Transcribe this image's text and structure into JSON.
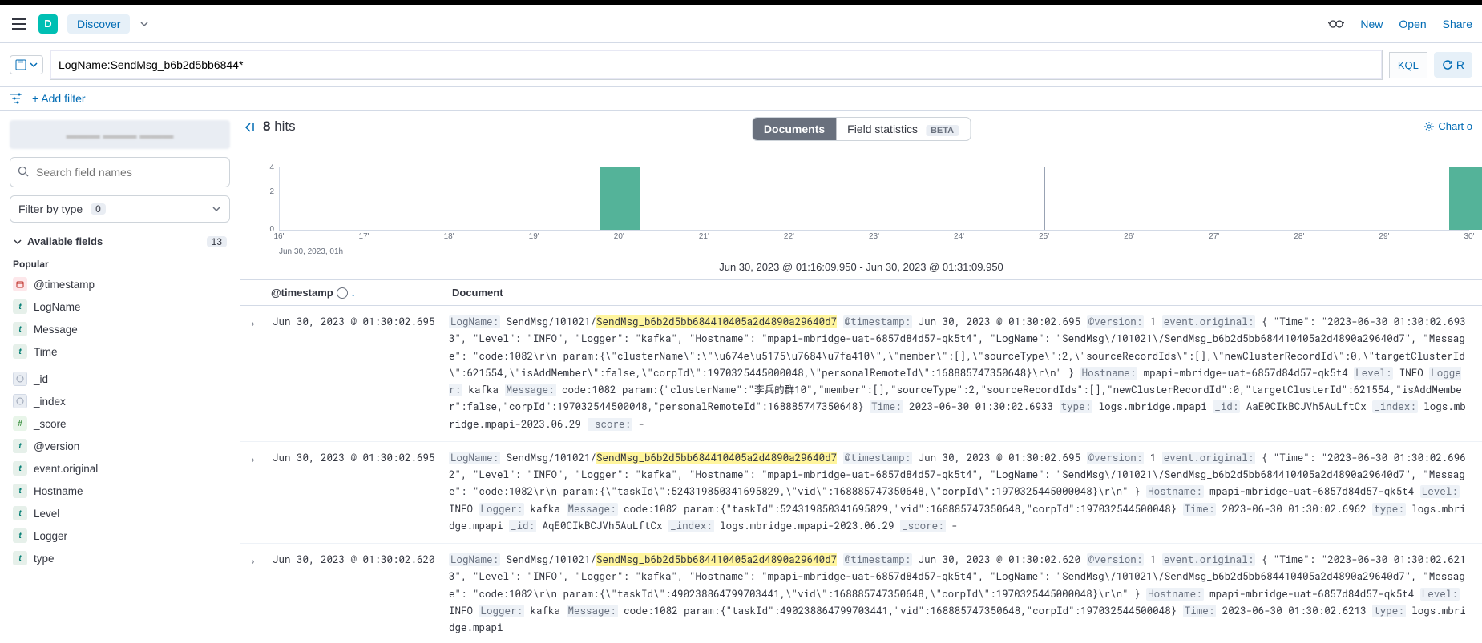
{
  "header": {
    "logo_letter": "D",
    "app_name": "Discover",
    "links": {
      "new": "New",
      "open": "Open",
      "share": "Share"
    }
  },
  "query": {
    "value": "LogName:SendMsg_b6b2d5bb6844*",
    "lang_badge": "KQL",
    "refresh_label": "R"
  },
  "filterbar": {
    "add_filter": "+ Add filter"
  },
  "sidebar": {
    "search_placeholder": "Search field names",
    "filter_type_label": "Filter by type",
    "filter_type_count": "0",
    "available_label": "Available fields",
    "available_count": "13",
    "popular_label": "Popular",
    "popular_fields": [
      {
        "token": "date",
        "name": "@timestamp"
      },
      {
        "token": "t",
        "name": "LogName"
      },
      {
        "token": "t",
        "name": "Message"
      },
      {
        "token": "t",
        "name": "Time"
      }
    ],
    "other_fields": [
      {
        "token": "id",
        "name": "_id"
      },
      {
        "token": "id",
        "name": "_index"
      },
      {
        "token": "hash",
        "name": "_score"
      },
      {
        "token": "t",
        "name": "@version"
      },
      {
        "token": "t",
        "name": "event.original"
      },
      {
        "token": "t",
        "name": "Hostname"
      },
      {
        "token": "t",
        "name": "Level"
      },
      {
        "token": "t",
        "name": "Logger"
      },
      {
        "token": "t",
        "name": "type"
      }
    ]
  },
  "results": {
    "hits_count": "8",
    "hits_label": "hits",
    "tabs": {
      "documents": "Documents",
      "field_stats": "Field statistics",
      "beta": "BETA"
    },
    "chart_options_label": "Chart o",
    "time_range": "Jun 30, 2023 @ 01:16:09.950 - Jun 30, 2023 @ 01:31:09.950",
    "columns": {
      "timestamp": "@timestamp",
      "document": "Document"
    },
    "rows": [
      {
        "ts": "Jun 30, 2023 @ 01:30:02.695",
        "logname_prefix": "SendMsg/101021/",
        "logname_hl": "SendMsg_b6b2d5bb684410405a2d4890a29640d7",
        "timestamp_val": "Jun 30, 2023 @ 01:30:02.695",
        "version": "1",
        "event_original": "{ \"Time\": \"2023-06-30 01:30:02.6933\", \"Level\": \"INFO\", \"Logger\": \"kafka\", \"Hostname\": \"mpapi-mbridge-uat-6857d84d57-qk5t4\", \"LogName\": \"SendMsg\\/101021\\/SendMsg_b6b2d5bb684410405a2d4890a29640d7\", \"Message\": \"code:1082\\r\\n  param:{\\\"clusterName\\\":\\\"\\u674e\\u5175\\u7684\\u7fa410\\\",\\\"member\\\":[],\\\"sourceType\\\":2,\\\"sourceRecordIds\\\":[],\\\"newClusterRecordId\\\":0,\\\"targetClusterId\\\":621554,\\\"isAddMember\\\":false,\\\"corpId\\\":1970325445000048,\\\"personalRemoteId\\\":168885747350648}\\r\\n\" }",
        "hostname": "mpapi-mbridge-uat-6857d84d57-qk5t4",
        "level": "INFO",
        "logger": "kafka",
        "message": "code:1082 param:{\"clusterName\":\"李兵的群10\",\"member\":[],\"sourceType\":2,\"sourceRecordIds\":[],\"newClusterRecordId\":0,\"targetClusterId\":621554,\"isAddMember\":false,\"corpId\":197032544500048,\"personalRemoteId\":168885747350648}",
        "time": "2023-06-30 01:30:02.6933",
        "type": "logs.mbridge.mpapi",
        "_id": "AaE0CIkBCJVh5AuLftCx",
        "_index": "logs.mbridge.mpapi-2023.06.29",
        "_score": "-"
      },
      {
        "ts": "Jun 30, 2023 @ 01:30:02.695",
        "logname_prefix": "SendMsg/101021/",
        "logname_hl": "SendMsg_b6b2d5bb684410405a2d4890a29640d7",
        "timestamp_val": "Jun 30, 2023 @ 01:30:02.695",
        "version": "1",
        "event_original": "{ \"Time\": \"2023-06-30 01:30:02.6962\", \"Level\": \"INFO\", \"Logger\": \"kafka\", \"Hostname\": \"mpapi-mbridge-uat-6857d84d57-qk5t4\", \"LogName\": \"SendMsg\\/101021\\/SendMsg_b6b2d5bb684410405a2d4890a29640d7\", \"Message\": \"code:1082\\r\\n  param:{\\\"taskId\\\":524319850341695829,\\\"vid\\\":168885747350648,\\\"corpId\\\":1970325445000048}\\r\\n\" }",
        "hostname": "mpapi-mbridge-uat-6857d84d57-qk5t4",
        "level": "INFO",
        "logger": "kafka",
        "message": "code:1082 param:{\"taskId\":524319850341695829,\"vid\":168885747350648,\"corpId\":197032544500048}",
        "time": "2023-06-30 01:30:02.6962",
        "type": "logs.mbridge.mpapi",
        "_id": "AqE0CIkBCJVh5AuLftCx",
        "_index": "logs.mbridge.mpapi-2023.06.29",
        "_score": "-"
      },
      {
        "ts": "Jun 30, 2023 @ 01:30:02.620",
        "logname_prefix": "SendMsg/101021/",
        "logname_hl": "SendMsg_b6b2d5bb684410405a2d4890a29640d7",
        "timestamp_val": "Jun 30, 2023 @ 01:30:02.620",
        "version": "1",
        "event_original": "{ \"Time\": \"2023-06-30 01:30:02.6213\", \"Level\": \"INFO\", \"Logger\": \"kafka\", \"Hostname\": \"mpapi-mbridge-uat-6857d84d57-qk5t4\", \"LogName\": \"SendMsg\\/101021\\/SendMsg_b6b2d5bb684410405a2d4890a29640d7\", \"Message\": \"code:1082\\r\\n  param:{\\\"taskId\\\":490238864799703441,\\\"vid\\\":168885747350648,\\\"corpId\\\":1970325445000048}\\r\\n\" }",
        "hostname": "mpapi-mbridge-uat-6857d84d57-qk5t4",
        "level": "INFO",
        "logger": "kafka",
        "message": "code:1082 param:{\"taskId\":490238864799703441,\"vid\":168885747350648,\"corpId\":197032544500048}",
        "time": "2023-06-30 01:30:02.6213",
        "type": "logs.mbridge.mpapi",
        "_id": "",
        "_index": "",
        "_score": ""
      }
    ]
  },
  "chart_data": {
    "type": "bar",
    "title": "",
    "xlabel": "Jun 30, 2023, 01h",
    "ylabel": "",
    "ylim": [
      0,
      4
    ],
    "categories": [
      "16'",
      "17'",
      "18'",
      "19'",
      "20'",
      "21'",
      "22'",
      "23'",
      "24'",
      "25'",
      "26'",
      "27'",
      "28'",
      "29'",
      "30'"
    ],
    "values": [
      0,
      0,
      0,
      0,
      4,
      0,
      0,
      0,
      0,
      0,
      0,
      0,
      0,
      0,
      4
    ],
    "separator_at_index": 9
  }
}
